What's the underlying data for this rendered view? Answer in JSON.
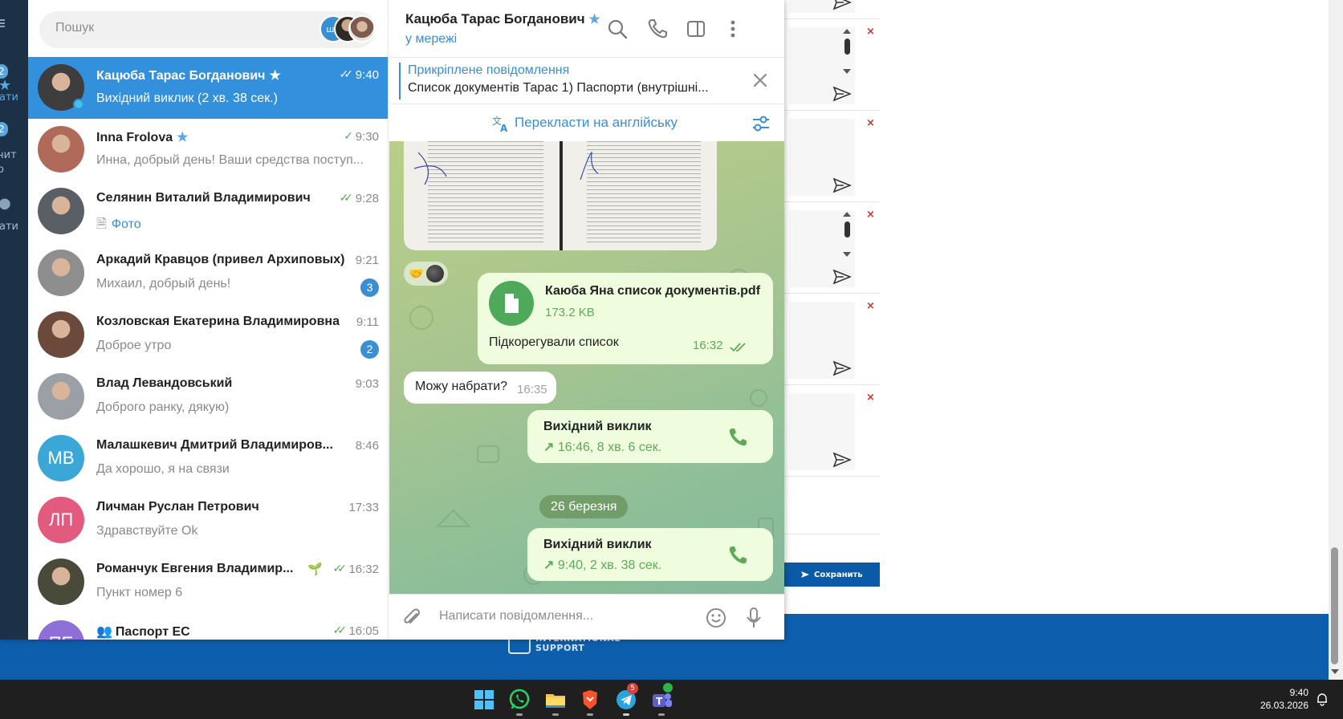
{
  "colors": {
    "telegram_accent": "#3390dc",
    "outgoing_bubble": "#effdde",
    "online_green": "#4fae4e",
    "badge_blue": "#3a8ed1",
    "footer_blue": "#0d5fae"
  },
  "background_page": {
    "save_button": "Сохранить",
    "footer_logo_line1": "INTERNATIONAL",
    "footer_logo_line2": "SUPPORT"
  },
  "folders": [
    {
      "badge": "2",
      "label": "ати"
    },
    {
      "badge": "2",
      "label": "чит",
      "label2": "о"
    },
    {
      "badge": "",
      "label": "ати"
    }
  ],
  "search": {
    "placeholder": "Пошук",
    "story_avatar_initials": "ШП"
  },
  "chats": [
    {
      "name": "Кацюба Тарас Богданович",
      "starred": true,
      "time": "9:40",
      "read": "double",
      "preview": "Вихідний виклик (2 хв. 38 сек.)",
      "avatar_initials": "",
      "avatar_color": "#3d3d3d",
      "unread": "",
      "active": true,
      "online": true
    },
    {
      "name": "Inna Frolova",
      "starred": true,
      "time": "9:30",
      "read": "single",
      "preview": "Инна, добрый день! Ваши средства поступ...",
      "avatar_initials": "",
      "avatar_color": "#b06a5a",
      "unread": ""
    },
    {
      "name": "Селянин Виталий Владимирович",
      "starred": false,
      "time": "9:28",
      "read": "double",
      "preview": "Фото",
      "preview_icon": "photo-thumb",
      "avatar_initials": "",
      "avatar_color": "#5a5f66",
      "unread": ""
    },
    {
      "name": "Аркадий Кравцов (привел Архиповых)",
      "starred": false,
      "time": "9:21",
      "read": "",
      "preview": "Михаил, добрый день!",
      "avatar_initials": "",
      "avatar_color": "#8e8e8e",
      "unread": "3"
    },
    {
      "name": "Козловская Екатерина Владимировна",
      "starred": false,
      "time": "9:11",
      "read": "",
      "preview": "Доброе утро",
      "avatar_initials": "",
      "avatar_color": "#6b4a3c",
      "unread": "2"
    },
    {
      "name": "Влад Левандовський",
      "starred": false,
      "time": "9:03",
      "read": "",
      "preview": "Доброго ранку, дякую)",
      "avatar_initials": "",
      "avatar_color": "#9aa0a6",
      "unread": ""
    },
    {
      "name": "Малашкевич Дмитрий Владимиров...",
      "starred": false,
      "time": "8:46",
      "read": "",
      "preview": "Да хорошо,  я на связи",
      "avatar_initials": "МВ",
      "avatar_color": "#3aa7d6",
      "unread": ""
    },
    {
      "name": "Личман Руслан Петрович",
      "starred": false,
      "time": "17:33",
      "read": "",
      "preview": "Здравствуйте  Ok",
      "avatar_initials": "ЛП",
      "avatar_color": "#e25a7e",
      "unread": ""
    },
    {
      "name": "Романчук Евгения Владимир...",
      "starred": false,
      "time": "16:32",
      "read": "double",
      "preview": "Пункт номер 6",
      "avatar_initials": "",
      "avatar_color": "#4a4a3a",
      "unread": "",
      "emoji": "🌱"
    },
    {
      "name": "Паспорт ЕС",
      "starred": false,
      "time": "16:05",
      "read": "double",
      "preview": "",
      "avatar_initials": "ПЕ",
      "avatar_color": "#8e6fd8",
      "unread": "",
      "group": true
    }
  ],
  "conversation": {
    "peer_name": "Кацюба Тарас Богданович",
    "peer_status": "у мережі",
    "pinned_title": "Прикріплене повідомлення",
    "pinned_text": "Список документів Тарас  1) Паспорти (внутрішні...",
    "translate_label": "Перекласти на англійську",
    "file_message": {
      "file_name": "Каюба Яна список документів.pdf",
      "file_size": "173.2 KB",
      "caption": "Підкорегували список",
      "time": "16:32"
    },
    "incoming_message": {
      "text": "Можу набрати?",
      "time": "16:35"
    },
    "call_1": {
      "title": "Вихідний виклик",
      "info": "16:46, 8 хв. 6 сек."
    },
    "date_separator": "26 березня",
    "call_2": {
      "title": "Вихідний виклик",
      "info": "9:40, 2 хв. 38 сек."
    },
    "composer_placeholder": "Написати повідомлення..."
  },
  "taskbar": {
    "apps": [
      "windows-start",
      "whatsapp",
      "file-explorer",
      "brave",
      "telegram",
      "teams"
    ],
    "telegram_badge": "5",
    "time": "9:40",
    "date": "26.03.2026"
  }
}
